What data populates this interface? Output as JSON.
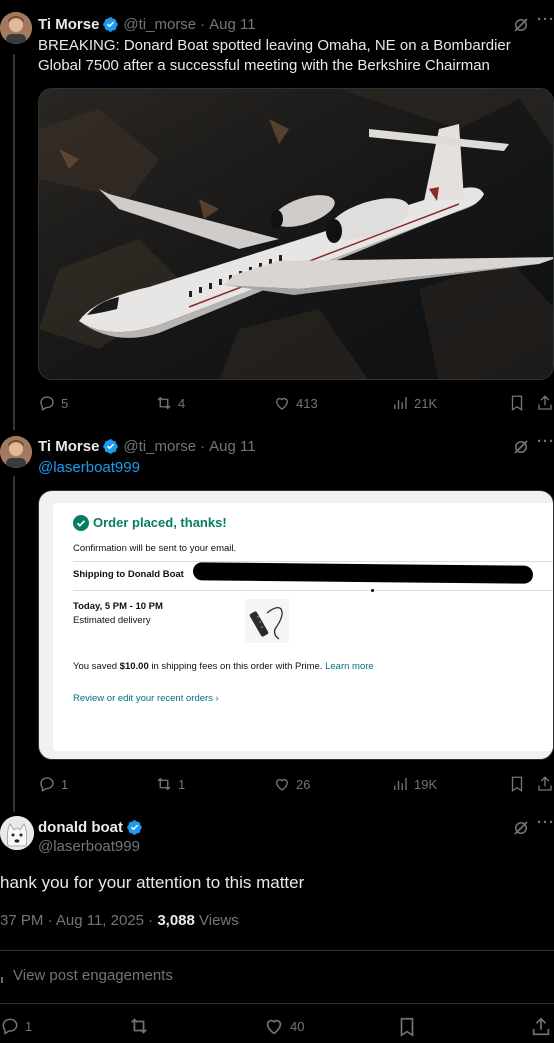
{
  "tweet1": {
    "display_name": "Ti Morse",
    "handle": "@ti_morse",
    "date": "Aug 11",
    "text": "BREAKING: Donard Boat spotted leaving Omaha, NE on a Bombardier Global 7500 after a successful meeting with the Berkshire Chairman",
    "replies": "5",
    "reposts": "4",
    "likes": "413",
    "views": "21K"
  },
  "tweet2": {
    "display_name": "Ti Morse",
    "handle": "@ti_morse",
    "date": "Aug 11",
    "mention": "@laserboat999",
    "replies": "1",
    "reposts": "1",
    "likes": "26",
    "views": "19K",
    "receipt": {
      "title": "Order placed, thanks!",
      "confirmation": "Confirmation will be sent to your email.",
      "shipping_label": "Shipping to Donald Boat",
      "delivery_window": "Today, 5 PM - 10 PM",
      "delivery_label": "Estimated delivery",
      "savings_prefix": "You saved ",
      "savings_amount": "$10.00",
      "savings_suffix": " in shipping fees on this order with Prime.",
      "learn_more": "Learn more",
      "review_link": "Review or edit your recent orders ›"
    }
  },
  "main_tweet": {
    "display_name": "donald boat",
    "handle": "@laserboat999",
    "text": "hank you for your attention to this matter",
    "time_date": "37 PM · Aug 11, 2025 · ",
    "views_count": "3,088",
    "views_label": " Views",
    "engagements": "View post engagements",
    "replies": "1",
    "likes": "40"
  },
  "colors": {
    "accent": "#1d9bf0",
    "muted": "#71767b",
    "prime_green": "#067d62"
  }
}
